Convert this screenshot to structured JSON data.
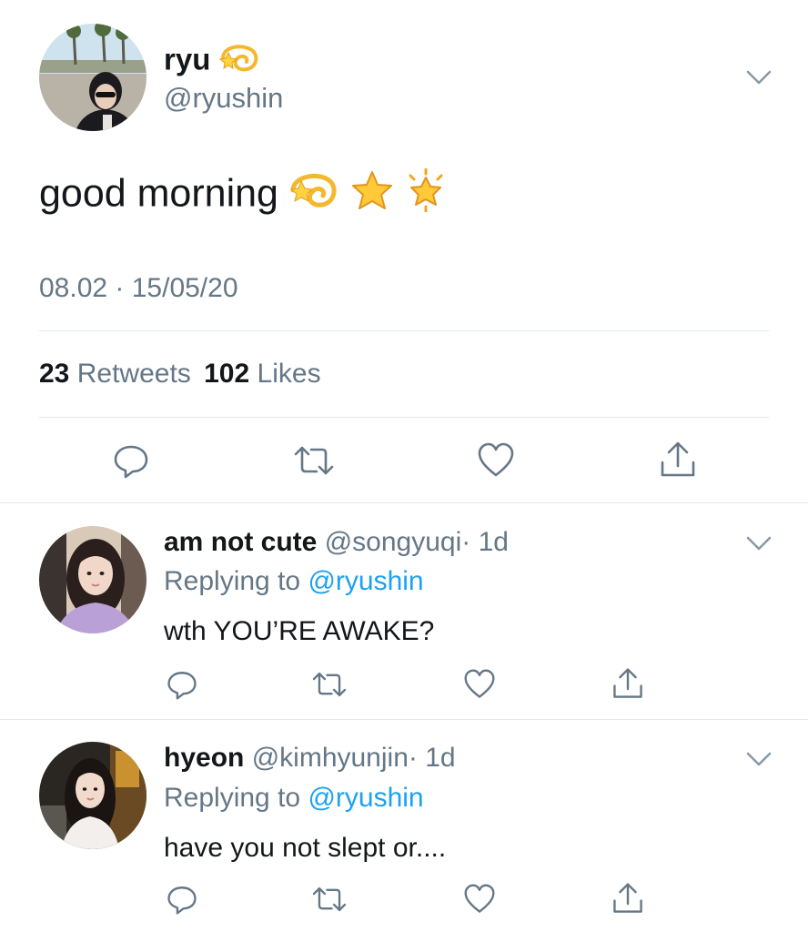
{
  "tweet": {
    "author_name": "ryu",
    "author_name_emoji": "dizzy-icon",
    "handle": "@ryushin",
    "text": "good morning",
    "text_emojis": [
      "dizzy-icon",
      "star-icon",
      "glowing-star-icon"
    ],
    "timestamp": "08.02 · 15/05/20",
    "retweets_count": "23",
    "retweets_label": "Retweets",
    "likes_count": "102",
    "likes_label": "Likes"
  },
  "replies": [
    {
      "name": "am not cute",
      "handle": "@songyuqi",
      "age": "· 1d",
      "replying_prefix": "Replying to",
      "replying_to": "@ryushin",
      "text": "wth YOU’RE AWAKE?"
    },
    {
      "name": "hyeon",
      "handle": "@kimhyunjin",
      "age": "· 1d",
      "replying_prefix": "Replying to",
      "replying_to": "@ryushin",
      "text": "have you not slept or...."
    }
  ],
  "colors": {
    "text": "#14171a",
    "secondary": "#657786",
    "link": "#1da1f2",
    "divider": "#e1e8ed"
  }
}
